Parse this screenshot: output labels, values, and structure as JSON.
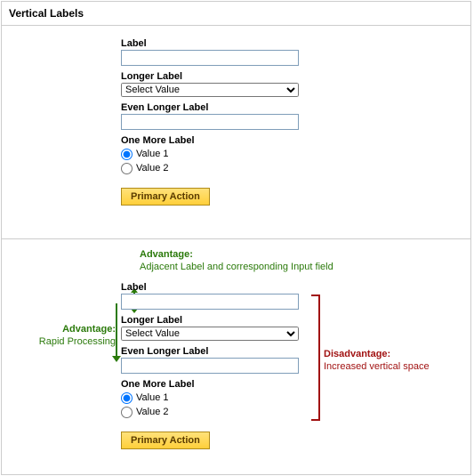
{
  "title": "Vertical Labels",
  "form": {
    "label1": "Label",
    "label2": "Longer Label",
    "select_value": "Select Value",
    "label3": "Even Longer Label",
    "label4": "One More Label",
    "radio1": "Value 1",
    "radio2": "Value 2",
    "button": "Primary Action"
  },
  "annotations": {
    "top_title": "Advantage:",
    "top_text": "Adjacent Label and corresponding Input field",
    "left_title": "Advantage:",
    "left_text": "Rapid Processing",
    "right_title": "Disadvantage:",
    "right_text": "Increased vertical space"
  }
}
